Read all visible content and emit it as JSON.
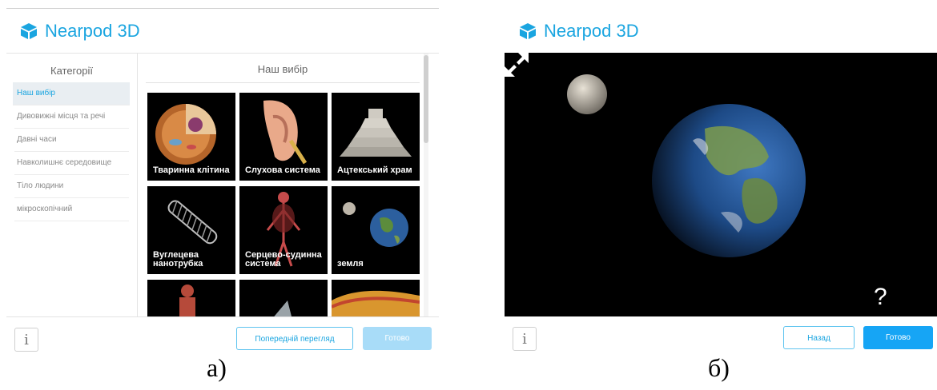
{
  "panel_a": {
    "brand": "Nearpod 3D",
    "sidebar": {
      "title": "Категорії",
      "items": [
        {
          "label": "Наш вибір",
          "active": true
        },
        {
          "label": "Дивовижні місця та речі"
        },
        {
          "label": "Давні часи"
        },
        {
          "label": "Навколишнє середовище"
        },
        {
          "label": "Тіло людини"
        },
        {
          "label": "мікроскопічний"
        }
      ]
    },
    "main_title": "Наш вибір",
    "tiles": [
      {
        "label": "Тваринна клітина",
        "icon": "animal-cell"
      },
      {
        "label": "Слухова система",
        "icon": "ear"
      },
      {
        "label": "Ацтекський храм",
        "icon": "aztec-temple"
      },
      {
        "label": "Вуглецева нанотрубка",
        "icon": "nanotube"
      },
      {
        "label": "Серцево-судинна система",
        "icon": "cardiovascular"
      },
      {
        "label": "земля",
        "icon": "earth"
      }
    ],
    "info_label": "i",
    "preview_button": "Попередній перегляд",
    "done_button": "Готово"
  },
  "panel_b": {
    "brand": "Nearpod 3D",
    "help_label": "?",
    "info_label": "i",
    "back_button": "Назад",
    "done_button": "Готово"
  },
  "captions": {
    "a": "а)",
    "b": "б)"
  },
  "colors": {
    "accent": "#1aa5e0",
    "button": "#16a5f5",
    "button_disabled": "#a8dcf8"
  }
}
